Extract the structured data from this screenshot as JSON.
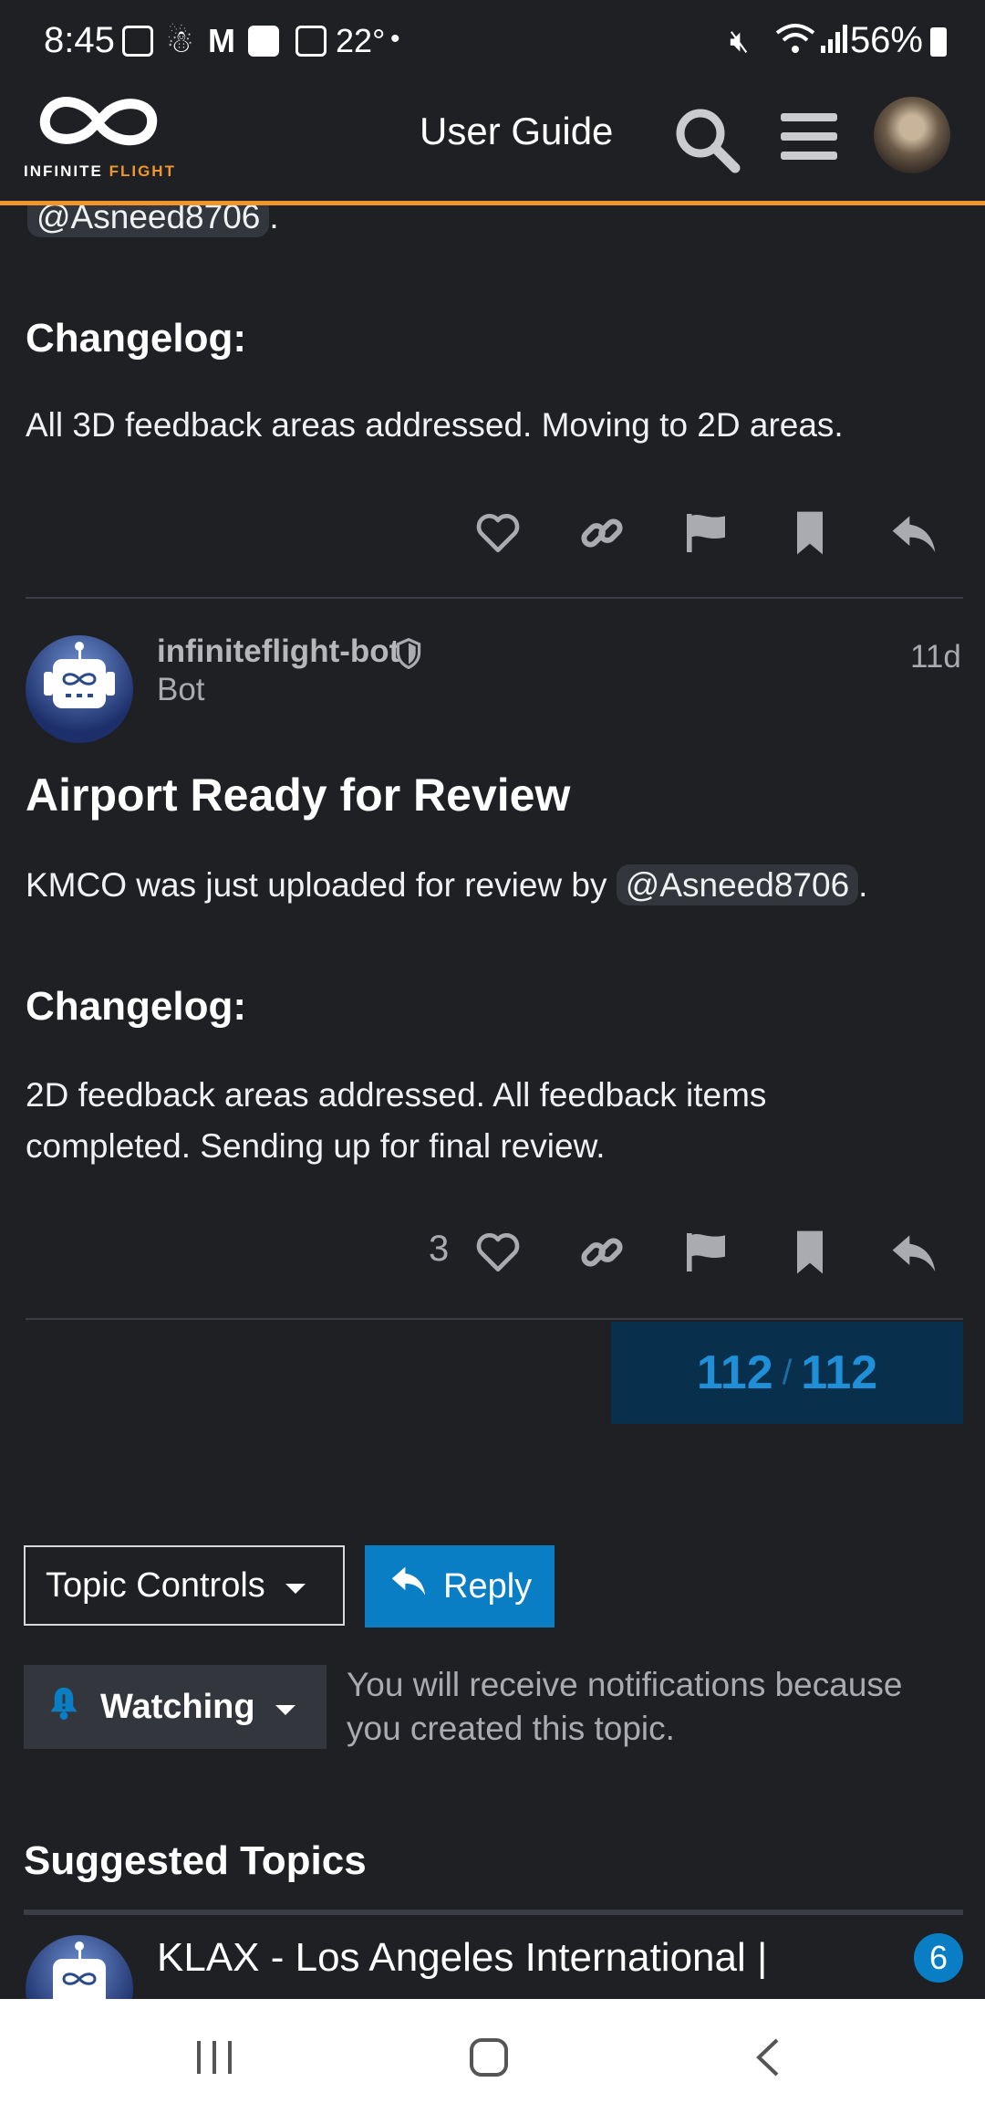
{
  "status_bar": {
    "time": "8:45",
    "temperature": "22°",
    "battery": "56%"
  },
  "header": {
    "logo_word1": "INFINITE",
    "logo_word2": "FLIGHT",
    "title": "User Guide",
    "accent_color": "#f0962a"
  },
  "post1": {
    "mention_top": "@Asneed8706",
    "changelog_heading": "Changelog:",
    "changelog_text": "All 3D feedback areas addressed. Moving to 2D areas."
  },
  "post2": {
    "username": "infiniteflight-bot",
    "user_title": "Bot",
    "age": "11d",
    "heading": "Airport Ready for Review",
    "body_prefix": "KMCO was just uploaded for review by",
    "mention": "@Asneed8706",
    "body_suffix": ".",
    "changelog_heading": "Changelog:",
    "changelog_line1": "2D feedback areas addressed. All feedback items",
    "changelog_line2": "completed. Sending up for final review.",
    "like_count": "3"
  },
  "progress": {
    "current": "112",
    "separator": "/",
    "total": "112"
  },
  "controls": {
    "topic_controls_label": "Topic Controls",
    "reply_label": "Reply",
    "watching_label": "Watching",
    "notification_line1": "You will receive notifications because",
    "notification_line2": "you created this topic."
  },
  "suggested": {
    "heading": "Suggested Topics",
    "first_topic": "KLAX - Los Angeles International |",
    "first_topic_count": "6"
  },
  "colors": {
    "background": "#1e2024",
    "primary_blue": "#0a7ec4",
    "progress_bg": "#08304d",
    "progress_text": "#1f8fd8"
  }
}
